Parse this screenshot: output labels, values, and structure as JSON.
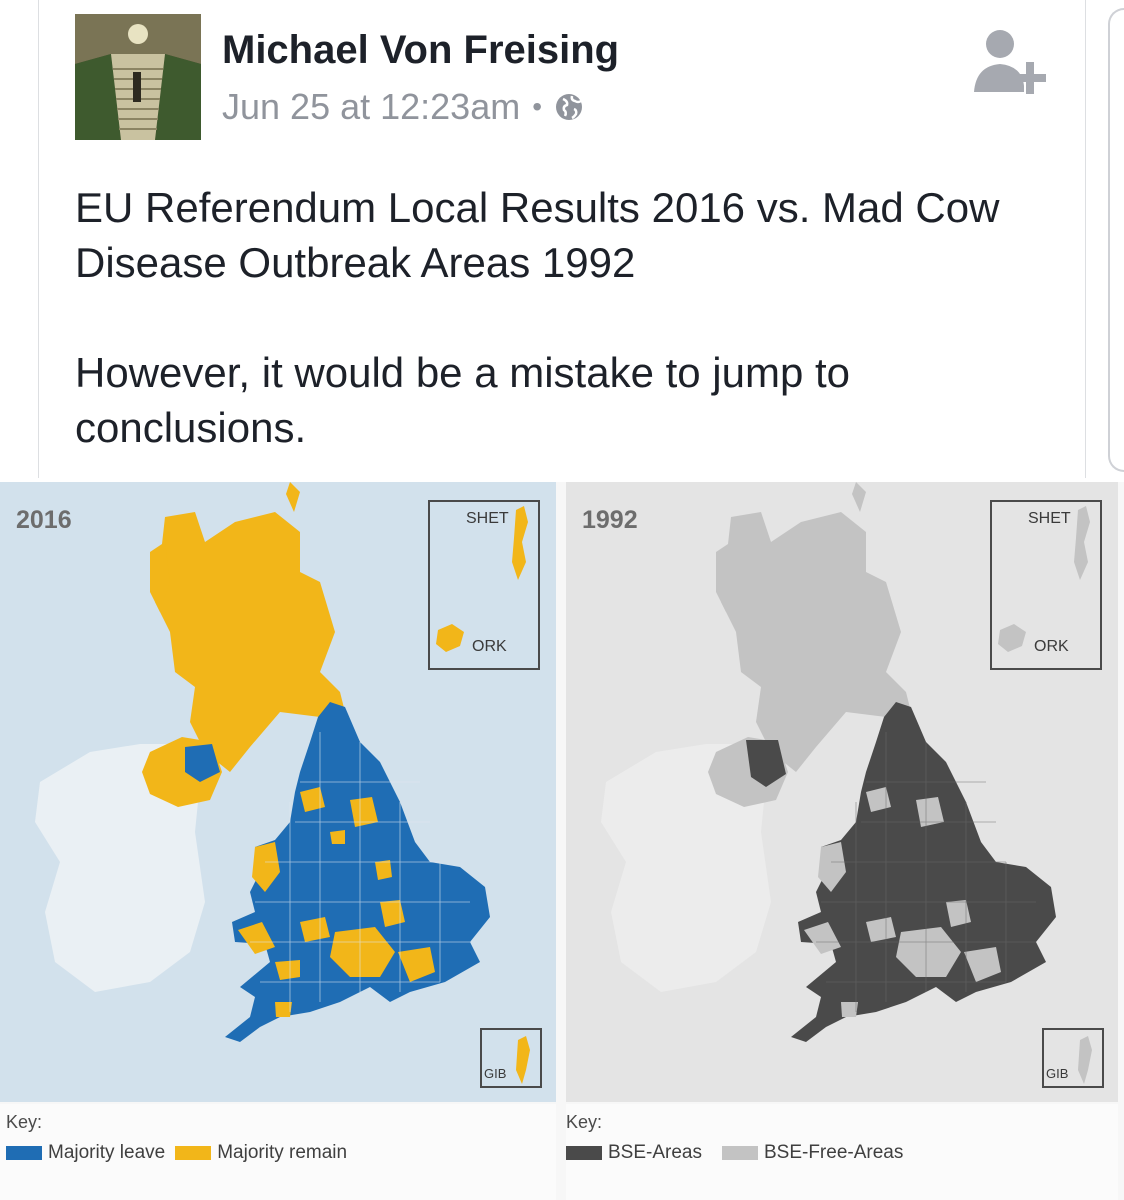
{
  "post": {
    "author": "Michael Von Freising",
    "timestamp": "Jun 25 at 12:23am",
    "separator": "•",
    "privacy_icon": "globe-icon",
    "add_friend_icon": "add-friend-icon",
    "text_para1": "EU Referendum Local Results 2016 vs. Mad Cow Disease Outbreak Areas 1992",
    "text_para2": "However, it would be a mistake to jump to conclusions."
  },
  "image": {
    "left_panel": {
      "year": "2016",
      "inset_shet": "SHET",
      "inset_ork": "ORK",
      "inset_gib": "GIB",
      "key_title": "Key:",
      "key_items": [
        {
          "label": "Majority leave",
          "color": "#1f6db4"
        },
        {
          "label": "Majority remain",
          "color": "#f2b619"
        }
      ]
    },
    "right_panel": {
      "year": "1992",
      "inset_shet": "SHET",
      "inset_ork": "ORK",
      "inset_gib": "GIB",
      "key_title": "Key:",
      "key_items": [
        {
          "label": "BSE-Areas",
          "color": "#4a4a4a"
        },
        {
          "label": "BSE-Free-Areas",
          "color": "#c3c3c3"
        }
      ]
    }
  },
  "colors": {
    "leave": "#1f6db4",
    "remain": "#f2b619",
    "ireland_left": "#eaf0f4",
    "sea_left": "#d2e1ec",
    "bse": "#4a4a4a",
    "bse_free": "#c3c3c3",
    "ireland_right": "#ececec",
    "sea_right": "#e4e4e4"
  }
}
